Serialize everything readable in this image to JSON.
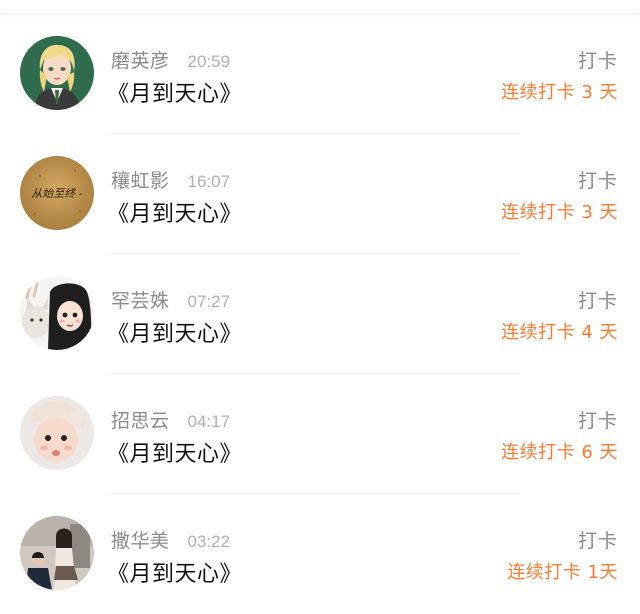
{
  "entries": [
    {
      "name": "磨英彦",
      "time": "20:59",
      "book": "《月到天心》",
      "action": "打卡",
      "streak": "连续打卡 3 天",
      "avatar_icon": "cartoon-girl-avatar"
    },
    {
      "name": "穰虹影",
      "time": "16:07",
      "book": "《月到天心》",
      "action": "打卡",
      "streak": "连续打卡 3 天",
      "avatar_icon": "text-avatar",
      "avatar_text": "从始至终 -"
    },
    {
      "name": "罕芸姝",
      "time": "07:27",
      "book": "《月到天心》",
      "action": "打卡",
      "streak": "连续打卡 4 天",
      "avatar_icon": "cartoon-girl-cat-avatar"
    },
    {
      "name": "招思云",
      "time": "04:17",
      "book": "《月到天心》",
      "action": "打卡",
      "streak": "连续打卡 6 天",
      "avatar_icon": "baby-photo-avatar"
    },
    {
      "name": "撒华美",
      "time": "03:22",
      "book": "《月到天心》",
      "action": "打卡",
      "streak": "连续打卡 1天",
      "avatar_icon": "couple-photo-avatar"
    }
  ],
  "colors": {
    "accent": "#ff7a2e",
    "name": "#8c8c8c",
    "time": "#b0b0b0",
    "title": "#111111"
  }
}
